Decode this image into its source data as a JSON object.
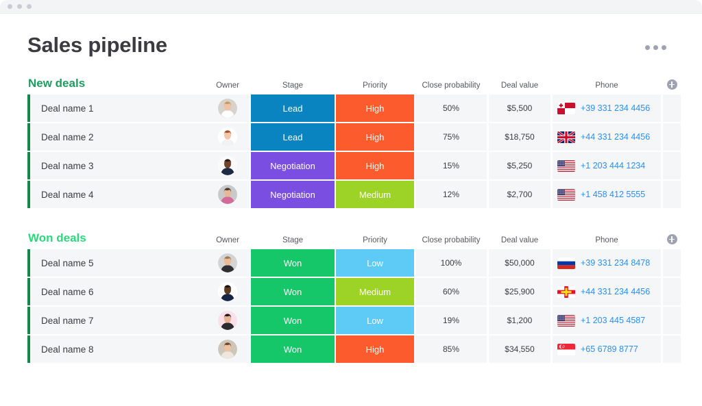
{
  "window": {
    "dots": 3
  },
  "header": {
    "title": "Sales pipeline",
    "menu_icon": "kebab-horizontal-icon"
  },
  "columns": {
    "name": "",
    "owner": "Owner",
    "stage": "Stage",
    "priority": "Priority",
    "close_probability": "Close probability",
    "deal_value": "Deal value",
    "phone": "Phone",
    "add": "add-column-icon"
  },
  "colors": {
    "stage_lead": "#0a84c1",
    "stage_negotiation": "#7a4ee0",
    "stage_won": "#16c76a",
    "priority_high": "#fb5b2d",
    "priority_medium": "#9cd326",
    "priority_low": "#5ecbf7",
    "accent_bar": "#14884b",
    "group_new": "#1f9d60",
    "group_won": "#2bd97c",
    "link": "#2a8ff5",
    "cell_bg": "#f5f6f8"
  },
  "groups": [
    {
      "title": "New deals",
      "color_key": "new",
      "rows": [
        {
          "name": "Deal name 1",
          "avatar": "avatar-woman-blonde",
          "stage": "Lead",
          "stage_color": "#0a84c1",
          "priority": "High",
          "priority_color": "#fb5b2d",
          "probability": "50%",
          "value": "$5,500",
          "flag": "tonga-flag",
          "phone": "+39 331 234 4456"
        },
        {
          "name": "Deal name 2",
          "avatar": "avatar-woman-redhead",
          "stage": "Lead",
          "stage_color": "#0a84c1",
          "priority": "High",
          "priority_color": "#fb5b2d",
          "probability": "75%",
          "value": "$18,750",
          "flag": "uk-flag",
          "phone": "+44 331 234 4456"
        },
        {
          "name": "Deal name 3",
          "avatar": "avatar-man-beard-dark",
          "stage": "Negotiation",
          "stage_color": "#7a4ee0",
          "priority": "High",
          "priority_color": "#fb5b2d",
          "probability": "15%",
          "value": "$5,250",
          "flag": "usa-flag",
          "phone": "+1 203 444 1234"
        },
        {
          "name": "Deal name 4",
          "avatar": "avatar-man-beard-light",
          "stage": "Negotiation",
          "stage_color": "#7a4ee0",
          "priority": "Medium",
          "priority_color": "#9cd326",
          "probability": "12%",
          "value": "$2,700",
          "flag": "usa-flag",
          "phone": "+1 458 412 5555"
        }
      ]
    },
    {
      "title": "Won deals",
      "color_key": "won",
      "rows": [
        {
          "name": "Deal name 5",
          "avatar": "avatar-man-blond",
          "stage": "Won",
          "stage_color": "#16c76a",
          "priority": "Low",
          "priority_color": "#5ecbf7",
          "probability": "100%",
          "value": "$50,000",
          "flag": "russia-flag",
          "phone": "+39 331 234 8478"
        },
        {
          "name": "Deal name 6",
          "avatar": "avatar-man-dark-suit",
          "stage": "Won",
          "stage_color": "#16c76a",
          "priority": "Medium",
          "priority_color": "#9cd326",
          "probability": "60%",
          "value": "$25,900",
          "flag": "guernsey-flag",
          "phone": "+44 331 234 4456"
        },
        {
          "name": "Deal name 7",
          "avatar": "avatar-woman-dark-hair",
          "stage": "Won",
          "stage_color": "#16c76a",
          "priority": "Low",
          "priority_color": "#5ecbf7",
          "probability": "19%",
          "value": "$1,200",
          "flag": "usa-flag",
          "phone": "+1 203 445 4587"
        },
        {
          "name": "Deal name 8",
          "avatar": "avatar-woman-brunette",
          "stage": "Won",
          "stage_color": "#16c76a",
          "priority": "High",
          "priority_color": "#fb5b2d",
          "probability": "85%",
          "value": "$34,550",
          "flag": "singapore-flag",
          "phone": "+65 6789 8777"
        }
      ]
    }
  ]
}
